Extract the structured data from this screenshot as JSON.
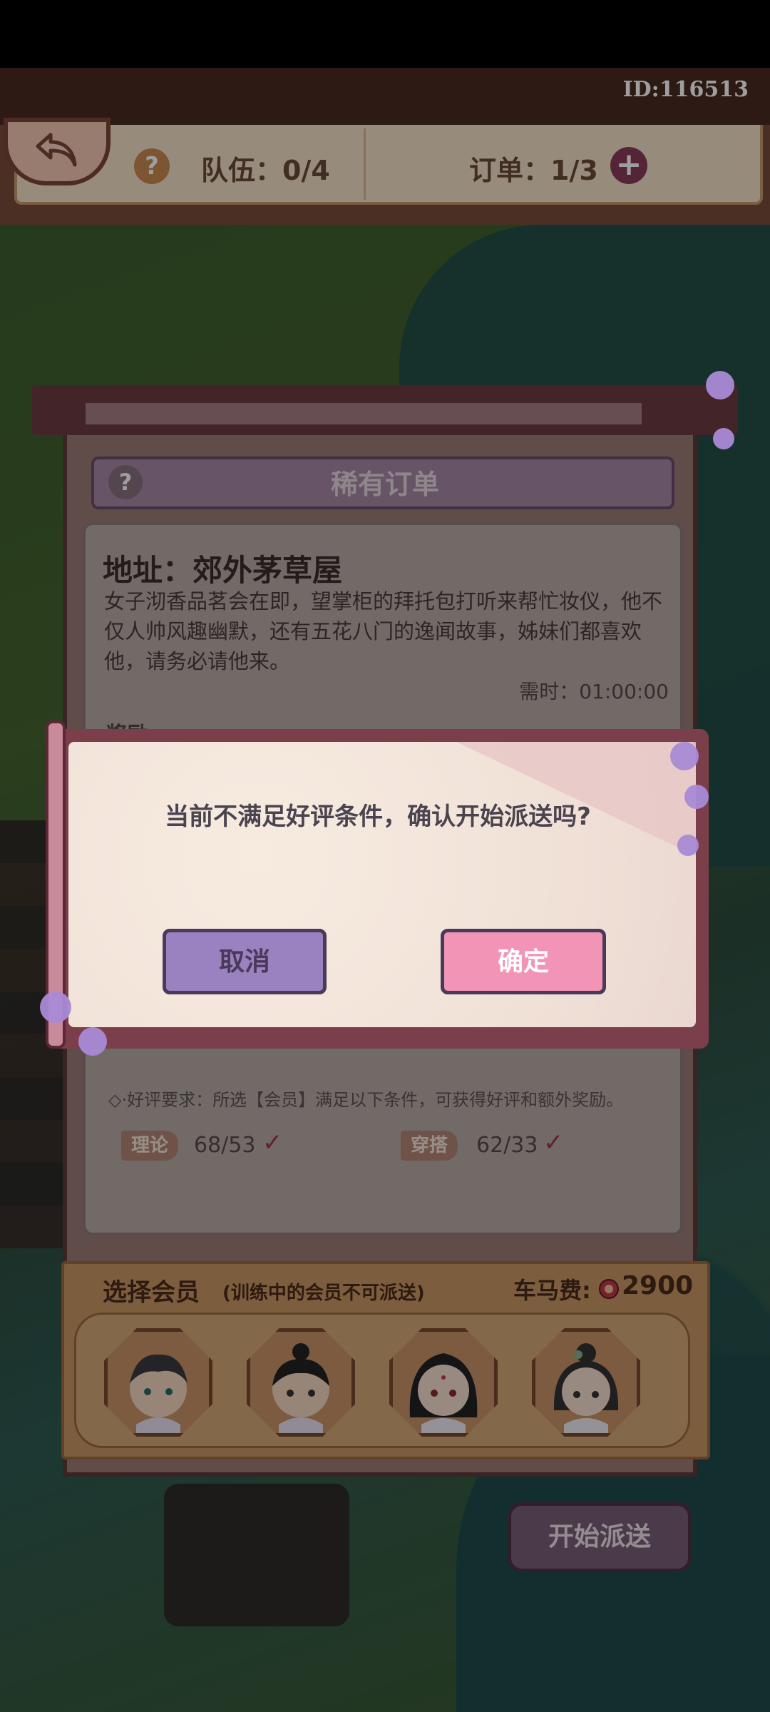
{
  "header": {
    "player_id": "ID:116513",
    "team_label": "队伍：0/4",
    "order_label": "订单：1/3"
  },
  "order": {
    "rarity_title": "稀有订单",
    "address": "地址：郊外茅草屋",
    "description": "女子沏香品茗会在即，望掌柜的拜托包打听来帮忙妆仪，他不仅人帅风趣幽默，还有五花八门的逸闻故事，姊妹们都喜欢他，请务必请他来。",
    "time_needed": "需时：01:00:00",
    "section_label": "奖励",
    "requirement_text": "◇·好评要求：所选【会员】满足以下条件，可获得好评和额外奖励。",
    "stats": [
      {
        "name": "理论",
        "value": "68/53"
      },
      {
        "name": "穿搭",
        "value": "62/33"
      }
    ]
  },
  "members": {
    "title": "选择会员",
    "note": "(训练中的会员不可派送)",
    "fee_label": "车马费:",
    "fee_value": "2900"
  },
  "dispatch_label": "开始派送",
  "dialog": {
    "message": "当前不满足好评条件，确认开始派送吗?",
    "cancel_label": "取消",
    "confirm_label": "确定"
  },
  "colors": {
    "accent": "#f294b5",
    "cancel": "#9a82c0",
    "panel": "#c89864"
  }
}
